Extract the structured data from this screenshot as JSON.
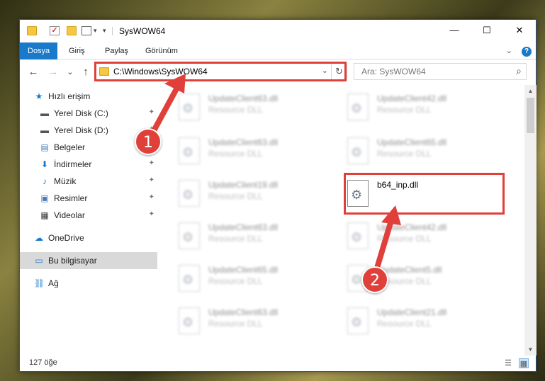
{
  "window": {
    "title": "SysWOW64",
    "controls": {
      "minimize": "—",
      "maximize": "☐",
      "close": "✕"
    }
  },
  "ribbon": {
    "tabs": [
      "Dosya",
      "Giriş",
      "Paylaş",
      "Görünüm"
    ],
    "expand_icon": "chevron-down-icon",
    "help": "?"
  },
  "navigation": {
    "back": "←",
    "forward": "→",
    "recent": "⌄",
    "up": "↑",
    "address": "C:\\Windows\\SysWOW64",
    "address_drop": "⌄",
    "refresh": "↻",
    "search_placeholder": "Ara: SysWOW64",
    "search_icon": "⌕"
  },
  "sidebar": {
    "items": [
      {
        "label": "Hızlı erişim",
        "icon": "★",
        "pinned": false
      },
      {
        "label": "Yerel Disk (C:)",
        "icon": "▬",
        "pinned": true
      },
      {
        "label": "Yerel Disk (D:)",
        "icon": "▬",
        "pinned": true
      },
      {
        "label": "Belgeler",
        "icon": "▤",
        "pinned": true
      },
      {
        "label": "İndirmeler",
        "icon": "⬇",
        "pinned": true
      },
      {
        "label": "Müzik",
        "icon": "♪",
        "pinned": true
      },
      {
        "label": "Resimler",
        "icon": "▣",
        "pinned": true
      },
      {
        "label": "Videolar",
        "icon": "▦",
        "pinned": true
      },
      {
        "label": "OneDrive",
        "icon": "☁",
        "pinned": false
      },
      {
        "label": "Bu bilgisayar",
        "icon": "▭",
        "pinned": false
      },
      {
        "label": "Ağ",
        "icon": "⛓",
        "pinned": false
      }
    ],
    "pin_glyph": "📌"
  },
  "files": [
    {
      "name": "UpdateClient63.dll",
      "type": "Resource DLL"
    },
    {
      "name": "UpdateClient42.dll",
      "type": "Resource DLL"
    },
    {
      "name": "UpdateClient63.dll",
      "type": "Resource DLL"
    },
    {
      "name": "UpdateClient65.dll",
      "type": "Resource DLL"
    },
    {
      "name": "UpdateClient19.dll",
      "type": "Resource DLL"
    },
    {
      "name": "b64_inp.dll",
      "type": ""
    },
    {
      "name": "UpdateClient63.dll",
      "type": "Resource DLL"
    },
    {
      "name": "UpdateClient42.dll",
      "type": "Resource DLL"
    },
    {
      "name": "UpdateClient65.dll",
      "type": "Resource DLL"
    },
    {
      "name": "UpdateClient5.dll",
      "type": "Resource DLL"
    },
    {
      "name": "UpdateClient63.dll",
      "type": "Resource DLL"
    },
    {
      "name": "UpdateClient21.dll",
      "type": "Resource DLL"
    }
  ],
  "status": {
    "count": "127 öğe"
  },
  "callouts": {
    "one": "1",
    "two": "2"
  },
  "colors": {
    "accent": "#1979ca",
    "highlight": "#e0403a"
  }
}
